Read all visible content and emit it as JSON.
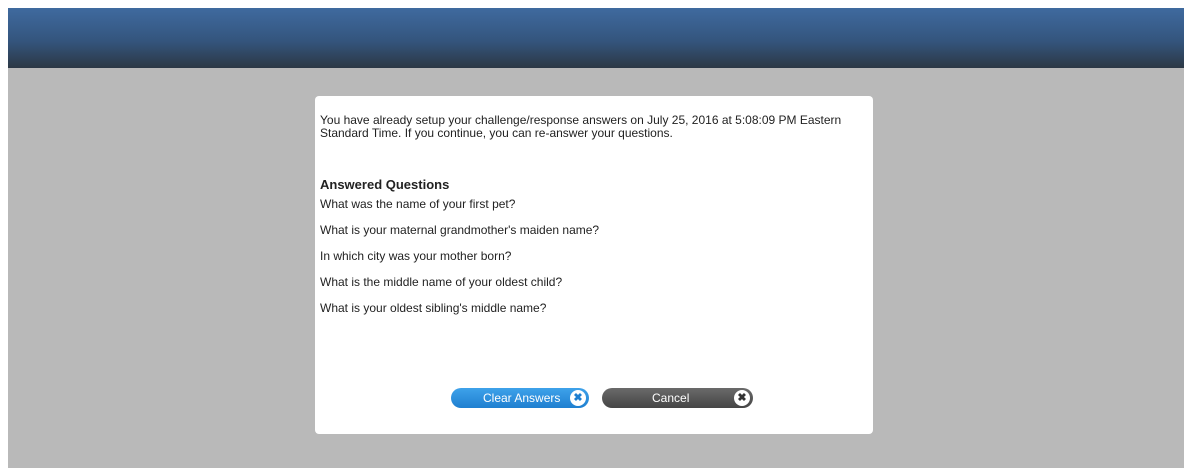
{
  "dialog": {
    "intro_text": "You have already setup your challenge/response answers on July 25, 2016 at 5:08:09 PM Eastern Standard Time. If you continue, you can re-answer your questions.",
    "section_title": "Answered Questions",
    "questions": [
      "What was the name of your first pet?",
      "What is your maternal grandmother's maiden name?",
      "In which city was your mother born?",
      "What is the middle name of your oldest child?",
      "What is your oldest sibling's middle name?"
    ]
  },
  "buttons": {
    "clear_label": "Clear Answers",
    "clear_icon": "close-icon",
    "cancel_label": "Cancel",
    "cancel_icon": "close-icon"
  },
  "colors": {
    "header": "#34557d",
    "backdrop": "#b9b9b9",
    "clear_button": "#1f7fd0",
    "cancel_button": "#555555"
  }
}
